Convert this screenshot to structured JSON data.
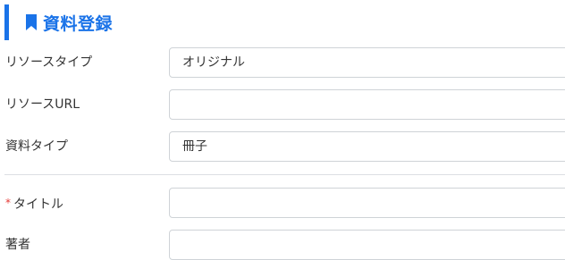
{
  "section": {
    "title": "資料登録",
    "icon": "bookmark-icon",
    "accent_color": "#1a73e8"
  },
  "fields": {
    "resource_type": {
      "label": "リソースタイプ",
      "value": "オリジナル"
    },
    "resource_url": {
      "label": "リソースURL",
      "value": ""
    },
    "material_type": {
      "label": "資料タイプ",
      "value": "冊子"
    },
    "title": {
      "label": "タイトル",
      "required_mark": "*",
      "value": ""
    },
    "author": {
      "label": "著者",
      "value": ""
    }
  },
  "colors": {
    "required": "#e53935",
    "border": "#cfd3d7"
  }
}
